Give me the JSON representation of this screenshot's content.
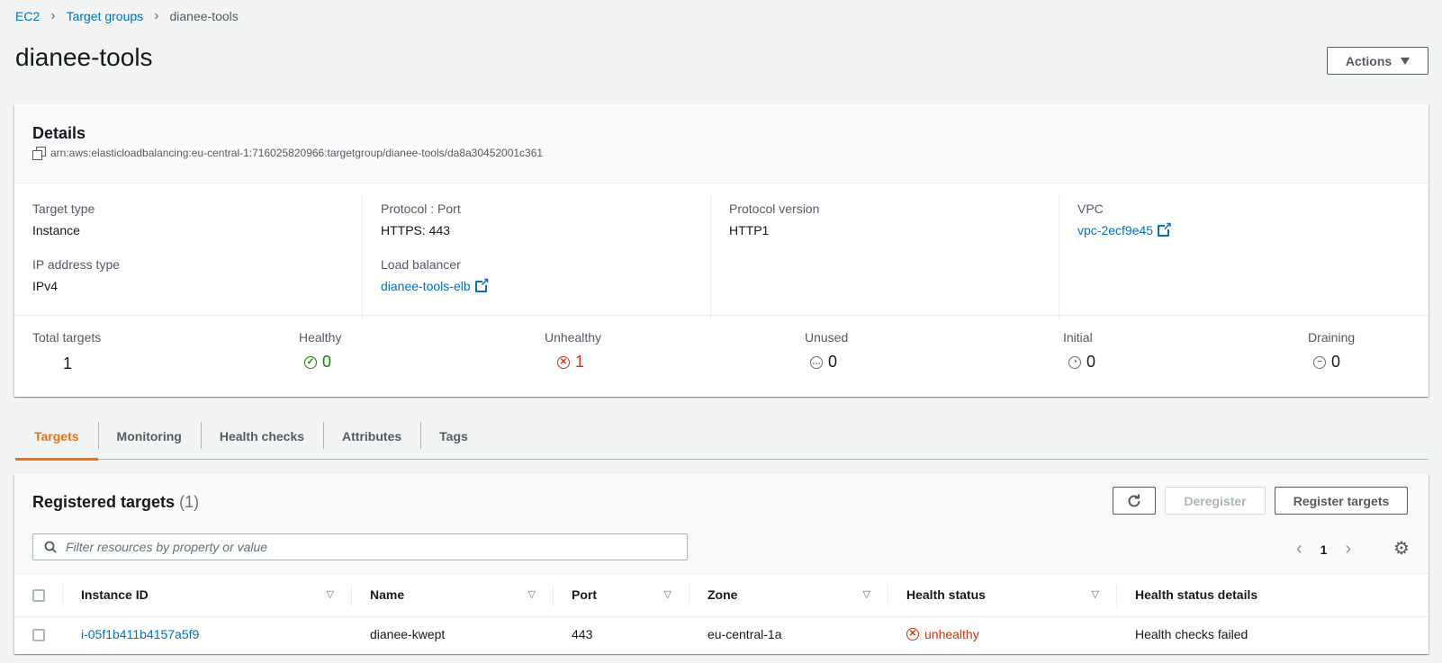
{
  "breadcrumb": {
    "items": [
      "EC2",
      "Target groups"
    ],
    "current": "dianee-tools"
  },
  "page": {
    "title": "dianee-tools",
    "actions_label": "Actions"
  },
  "details": {
    "title": "Details",
    "arn": "arn:aws:elasticloadbalancing:eu-central-1:716025820966:targetgroup/dianee-tools/da8a30452001c361",
    "target_type": {
      "label": "Target type",
      "value": "Instance"
    },
    "ip_type": {
      "label": "IP address type",
      "value": "IPv4"
    },
    "protocol_port": {
      "label": "Protocol : Port",
      "value": "HTTPS: 443"
    },
    "load_balancer": {
      "label": "Load balancer",
      "value": "dianee-tools-elb"
    },
    "protocol_version": {
      "label": "Protocol version",
      "value": "HTTP1"
    },
    "vpc": {
      "label": "VPC",
      "value": "vpc-2ecf9e45"
    }
  },
  "stats": {
    "total": {
      "label": "Total targets",
      "value": "1"
    },
    "healthy": {
      "label": "Healthy",
      "value": "0"
    },
    "unhealthy": {
      "label": "Unhealthy",
      "value": "1"
    },
    "unused": {
      "label": "Unused",
      "value": "0"
    },
    "initial": {
      "label": "Initial",
      "value": "0"
    },
    "draining": {
      "label": "Draining",
      "value": "0"
    }
  },
  "tabs": [
    "Targets",
    "Monitoring",
    "Health checks",
    "Attributes",
    "Tags"
  ],
  "active_tab": "Targets",
  "targets": {
    "title": "Registered targets",
    "count": "(1)",
    "deregister_label": "Deregister",
    "register_label": "Register targets",
    "search_placeholder": "Filter resources by property or value",
    "page": "1",
    "columns": [
      "Instance ID",
      "Name",
      "Port",
      "Zone",
      "Health status",
      "Health status details"
    ],
    "rows": [
      {
        "instance_id": "i-05f1b411b4157a5f9",
        "name": "dianee-kwept",
        "port": "443",
        "zone": "eu-central-1a",
        "health_status": "unhealthy",
        "health_details": "Health checks failed"
      }
    ]
  },
  "colors": {
    "link": "#0073bb",
    "accent": "#ec7211",
    "healthy": "#1d8102",
    "unhealthy": "#d13212"
  }
}
